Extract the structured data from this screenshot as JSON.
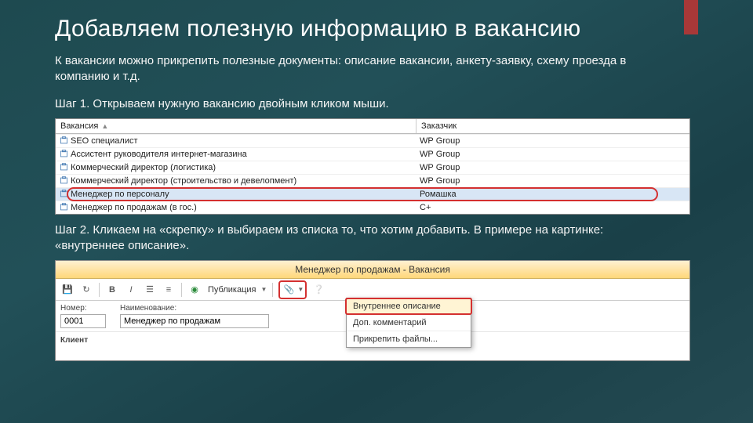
{
  "title": "Добавляем полезную информацию в вакансию",
  "intro": "К вакансии можно прикрепить полезные документы: описание вакансии, анкету-заявку, схему проезда в компанию и т.д.",
  "step1": "Шаг 1. Открываем нужную вакансию двойным кликом мыши.",
  "step2": "Шаг 2. Кликаем на «скрепку» и выбираем из списка то, что хотим добавить. В примере на картинке: «внутреннее описание».",
  "grid": {
    "col_vacancy": "Вакансия",
    "col_customer": "Заказчик",
    "rows": [
      {
        "v": "SЕО специалист",
        "z": "WР Group"
      },
      {
        "v": "Ассистент руководителя интернет-магазина",
        "z": "WР Group"
      },
      {
        "v": "Коммерческий директор (логистика)",
        "z": "WР Group"
      },
      {
        "v": "Коммерческий директор (строительство и девелопмент)",
        "z": "WР Group"
      },
      {
        "v": "Менеджер по персоналу",
        "z": "Ромашка",
        "sel": true
      },
      {
        "v": "Менеджер по продажам (в гос.)",
        "z": "С+"
      }
    ]
  },
  "window": {
    "title": "Менеджер по продажам - Вакансия",
    "publication": "Публикация",
    "fields": {
      "num_label": "Номер:",
      "num_value": "0001",
      "name_label": "Наименование:",
      "name_value": "Менеджер по продажам",
      "client_label": "Клиент"
    },
    "menu": {
      "i1": "Внутреннее описание",
      "i2": "Доп. комментарий",
      "i3": "Прикрепить файлы..."
    }
  }
}
